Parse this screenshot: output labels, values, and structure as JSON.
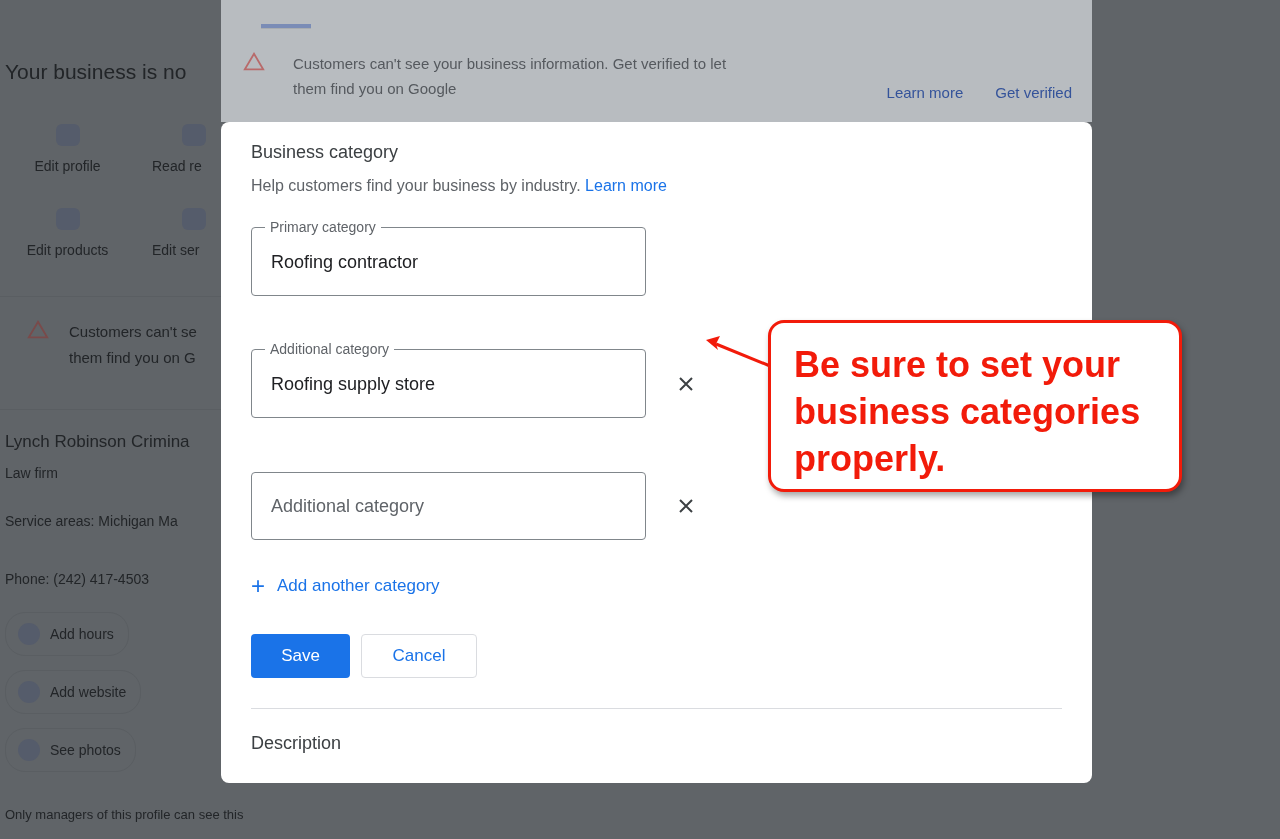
{
  "background_page": {
    "heading": "Your business is no",
    "actions": [
      {
        "label": "Edit profile"
      },
      {
        "label": "Read re"
      },
      {
        "label": "Edit products"
      },
      {
        "label": "Edit ser"
      }
    ],
    "alert": [
      "Customers can't se",
      "them find you on G"
    ],
    "business_name": "Lynch Robinson Crimina",
    "business_type": "Law firm",
    "service_areas": "Service areas: Michigan Ma",
    "phone": "Phone: (242) 417-4503",
    "chips": [
      {
        "label": "Add hours"
      },
      {
        "label": "Add website"
      },
      {
        "label": "See photos"
      }
    ],
    "footer": "Only managers of this profile can see this"
  },
  "background_dialog": {
    "alert": [
      "Customers can't see your business information. Get verified to let",
      "them find you on Google"
    ],
    "links": [
      "Learn more",
      "Get verified"
    ]
  },
  "dialog": {
    "title": "Business category",
    "help": "Help customers find your business by industry.",
    "help_link": "Learn more",
    "fields": [
      {
        "label": "Primary category",
        "value": "Roofing contractor",
        "removable": false
      },
      {
        "label": "Additional category",
        "value": "Roofing supply store",
        "removable": true
      },
      {
        "placeholder": "Additional category",
        "removable": true
      }
    ],
    "add_link": "Add another category",
    "add_icon": "+",
    "buttons": [
      {
        "label": "Save",
        "kind": "primary"
      },
      {
        "label": "Cancel",
        "kind": "secondary"
      }
    ],
    "next_section": "Description"
  },
  "callout": {
    "text": "Be sure to set your business categories properly."
  }
}
